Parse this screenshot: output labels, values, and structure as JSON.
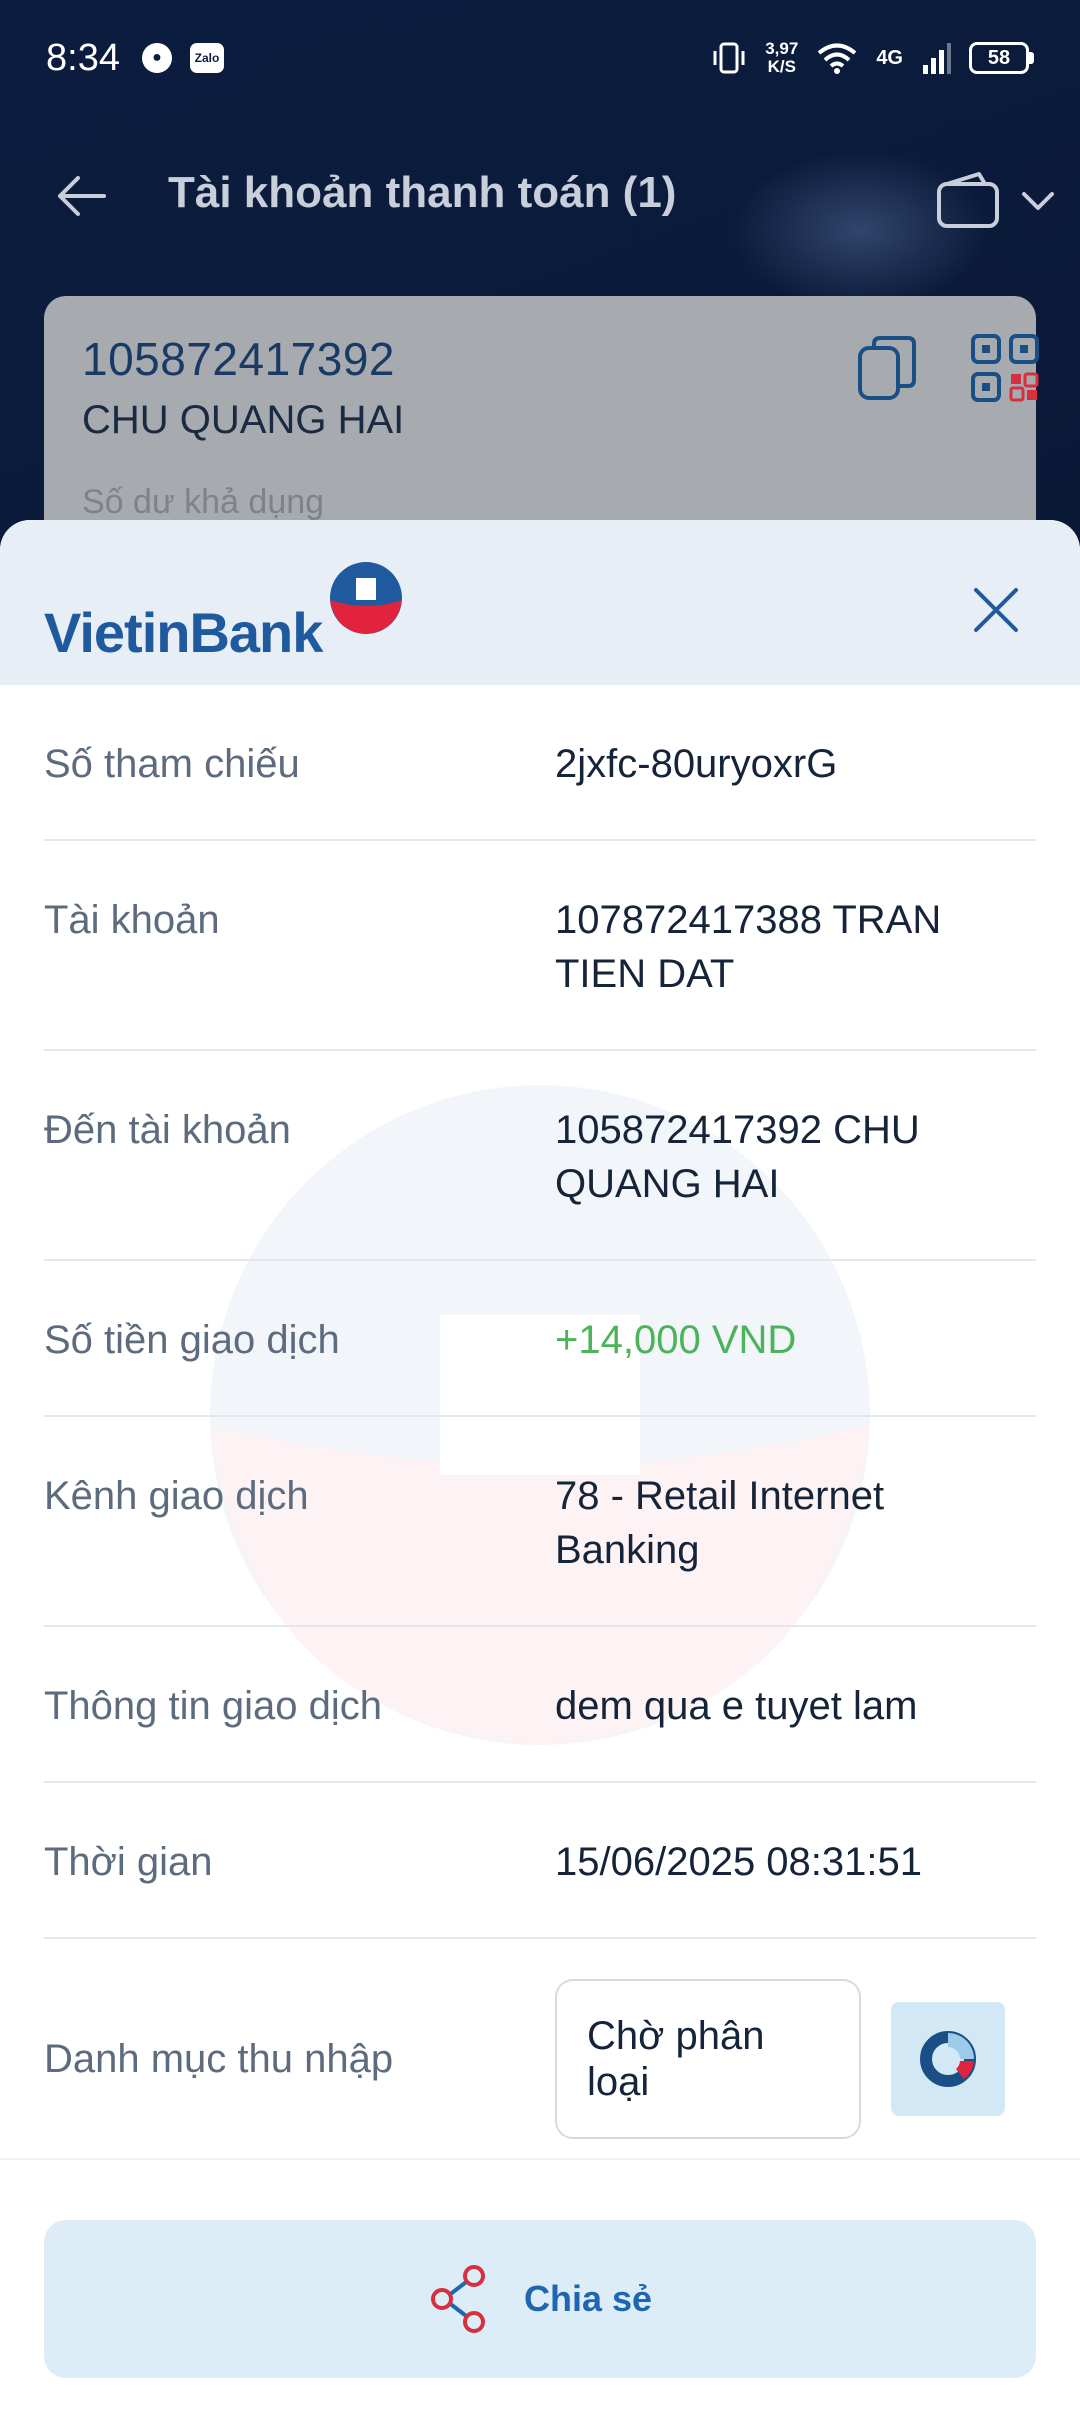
{
  "status_bar": {
    "time": "8:34",
    "zalo": "Zalo",
    "speed_value": "3,97",
    "speed_unit": "K/S",
    "network": "4G",
    "battery": "58"
  },
  "header": {
    "title": "Tài khoản thanh toán (1)"
  },
  "account_card": {
    "number": "105872417392",
    "name": "CHU QUANG HAI",
    "balance_label": "Số dư khả dụng"
  },
  "sheet": {
    "logo_text": "VietinBank",
    "rows": [
      {
        "label": "Số tham chiếu",
        "value": "2jxfc-80uryoxrG"
      },
      {
        "label": "Tài khoản",
        "value": "107872417388 TRAN TIEN DAT"
      },
      {
        "label": "Đến tài khoản",
        "value": "105872417392 CHU QUANG HAI"
      },
      {
        "label": "Số tiền giao dịch",
        "value": "+14,000 VND"
      },
      {
        "label": "Kênh giao dịch",
        "value": "78 - Retail Internet Banking"
      },
      {
        "label": "Thông tin giao dịch",
        "value": "dem qua e tuyet lam"
      },
      {
        "label": "Thời gian",
        "value": "15/06/2025 08:31:51"
      }
    ],
    "category": {
      "label": "Danh mục thu nhập",
      "value": "Chờ phân loại"
    },
    "share_label": "Chia sẻ"
  },
  "colors": {
    "brand_blue": "#1f5a9e",
    "brand_red": "#e2233d",
    "amount_green": "#4cb35a",
    "share_bg": "#dcedf8"
  },
  "icons": {
    "back": "arrow-left-icon",
    "wallet": "wallet-icon",
    "chevron": "chevron-down-icon",
    "copy": "copy-icon",
    "qr": "qr-code-icon",
    "close": "close-icon",
    "category": "pie-chart-icon",
    "share": "share-icon"
  }
}
